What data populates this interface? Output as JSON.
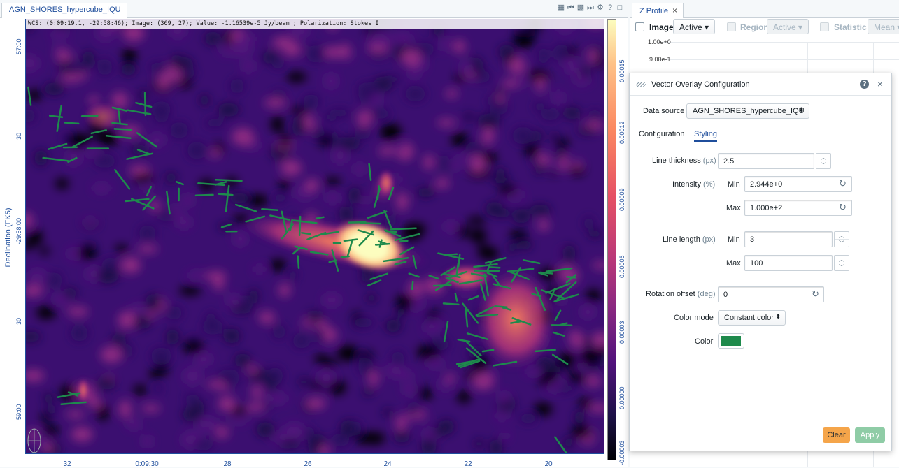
{
  "viewer": {
    "tab_title": "AGN_SHORES_hypercube_IQU",
    "cursor_info": "WCS: (0:09:19.1, -29:58:46); Image: (369, 27); Value: -1.16539e-5 Jy/beam ; Polarization: Stokes I",
    "y_axis_label": "Declination (FK5)",
    "y_ticks": [
      "57:00",
      "30",
      "-29:58:00",
      "30",
      "59:00"
    ],
    "x_ticks": [
      "32",
      "0:09:30",
      "28",
      "26",
      "24",
      "22",
      "20"
    ],
    "colorbar_ticks": [
      "0.00015",
      "0.00012",
      "0.00009",
      "0.00006",
      "0.00003",
      "0.00000",
      "-0.00003"
    ]
  },
  "profile": {
    "tab_title": "Z Profile",
    "image_label": "Image",
    "image_select": "Active",
    "region_label": "Region",
    "region_select": "Active",
    "statistic_label": "Statistic",
    "statistic_select": "Mean",
    "y_ticks": [
      "1.00e+0",
      "9.00e-1"
    ]
  },
  "dialog": {
    "title": "Vector Overlay Configuration",
    "data_source_label": "Data source",
    "data_source_value": "AGN_SHORES_hypercube_IQU",
    "tabs": [
      "Configuration",
      "Styling"
    ],
    "line_thickness_label": "Line thickness",
    "line_thickness_unit": "(px)",
    "line_thickness_value": "2.5",
    "intensity_label": "Intensity",
    "intensity_unit": "(%)",
    "min_label": "Min",
    "max_label": "Max",
    "intensity_min": "2.944e+0",
    "intensity_max": "1.000e+2",
    "line_length_label": "Line length",
    "line_length_unit": "(px)",
    "line_length_min": "3",
    "line_length_max": "100",
    "rotation_offset_label": "Rotation offset",
    "rotation_offset_unit": "(deg)",
    "rotation_offset_value": "0",
    "color_mode_label": "Color mode",
    "color_mode_value": "Constant color",
    "color_label": "Color",
    "color_value": "#1e8a4c",
    "clear_label": "Clear",
    "apply_label": "Apply",
    "clear_color": "#f5a54a",
    "apply_color": "#8fcca6"
  }
}
